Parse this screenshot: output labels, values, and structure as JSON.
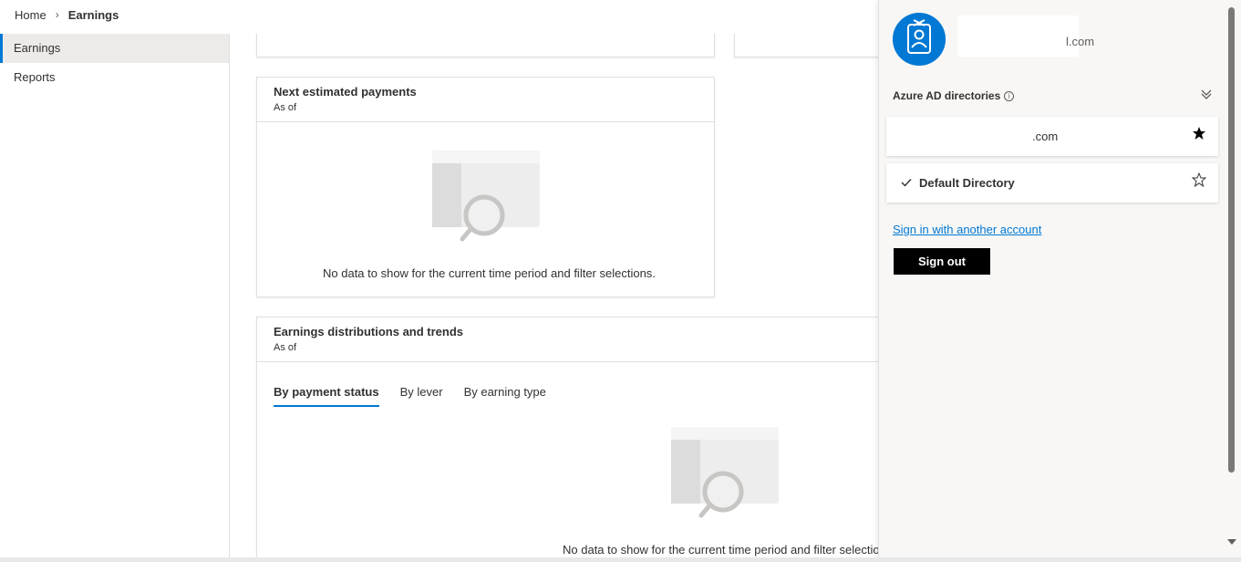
{
  "breadcrumb": {
    "home": "Home",
    "separator": "›",
    "current": "Earnings"
  },
  "nav": {
    "items": [
      {
        "label": "Earnings",
        "active": true
      },
      {
        "label": "Reports",
        "active": false
      }
    ]
  },
  "cards": {
    "next_payments": {
      "title": "Next estimated payments",
      "subtitle": "As of",
      "empty_text": "No data to show for the current time period and filter selections."
    },
    "distributions": {
      "title": "Earnings distributions and trends",
      "subtitle": "As of",
      "tabs": [
        "By payment status",
        "By lever",
        "By earning type"
      ],
      "active_tab": "By payment status",
      "empty_text": "No data to show for the current time period and filter selections."
    }
  },
  "account_panel": {
    "email_suffix": "l.com",
    "directories_heading": "Azure AD directories",
    "info_glyph": "i",
    "directories": [
      {
        "name": ".com",
        "favorite": true,
        "selected": false
      },
      {
        "name": "Default Directory",
        "favorite": false,
        "selected": true
      }
    ],
    "sign_in_other": "Sign in with another account",
    "sign_out": "Sign out"
  },
  "colors": {
    "accent": "#0078d4",
    "panel_bg": "#f8f7f5",
    "nav_active_bg": "#edebe9"
  }
}
